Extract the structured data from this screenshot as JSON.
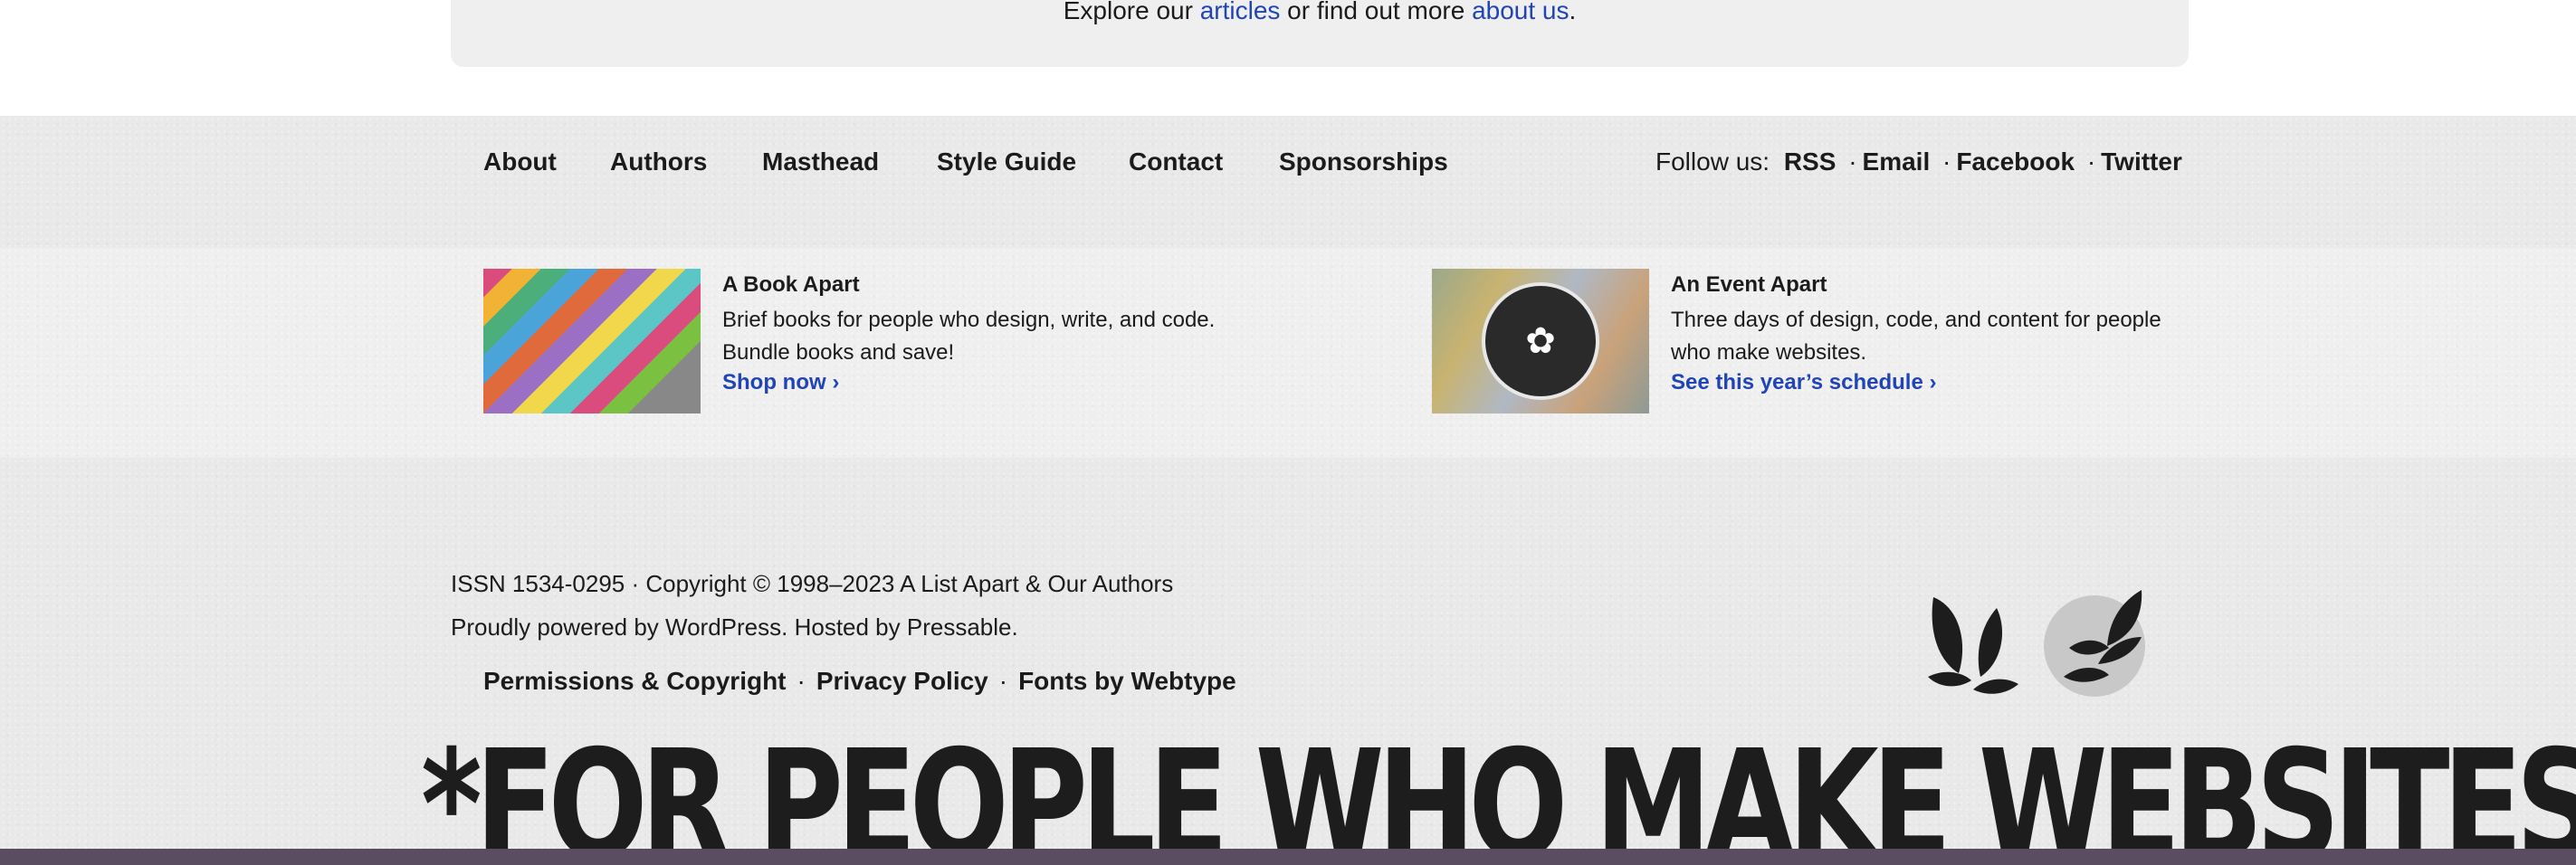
{
  "top_card": {
    "prefix": "Explore our ",
    "articles_link": "articles",
    "middle": " or find out more ",
    "about_link": "about us",
    "suffix": "."
  },
  "nav": {
    "items": [
      "About",
      "Authors",
      "Masthead",
      "Style Guide",
      "Contact",
      "Sponsorships"
    ]
  },
  "follow": {
    "label": "Follow us:",
    "links": [
      "RSS",
      "Email",
      "Facebook",
      "Twitter"
    ],
    "separator": "·"
  },
  "promos": [
    {
      "title": "A Book Apart",
      "desc": "Brief books for people who design, write, and code. Bundle books and save!",
      "cta": "Shop now ›",
      "image_icon": "books-image"
    },
    {
      "title": "An Event Apart",
      "desc": "Three days of design, code, and content for people who make websites.",
      "cta": "See this year’s schedule ›",
      "image_icon": "event-badge-image"
    }
  ],
  "footer": {
    "copyright": "ISSN 1534-0295 · Copyright © 1998–2023 A List Apart & Our Authors",
    "powered": "Proudly powered by WordPress. Hosted by Pressable.",
    "legal_links": [
      "Permissions & Copyright",
      "Privacy Policy",
      "Fonts by Webtype"
    ],
    "legal_separator": "·"
  },
  "tagline": "*FOR PEOPLE WHO MAKE WEBSITES",
  "colors": {
    "link_blue": "#2144b7",
    "text": "#1b1b1b",
    "bottom_bar": "#5a4d62"
  }
}
